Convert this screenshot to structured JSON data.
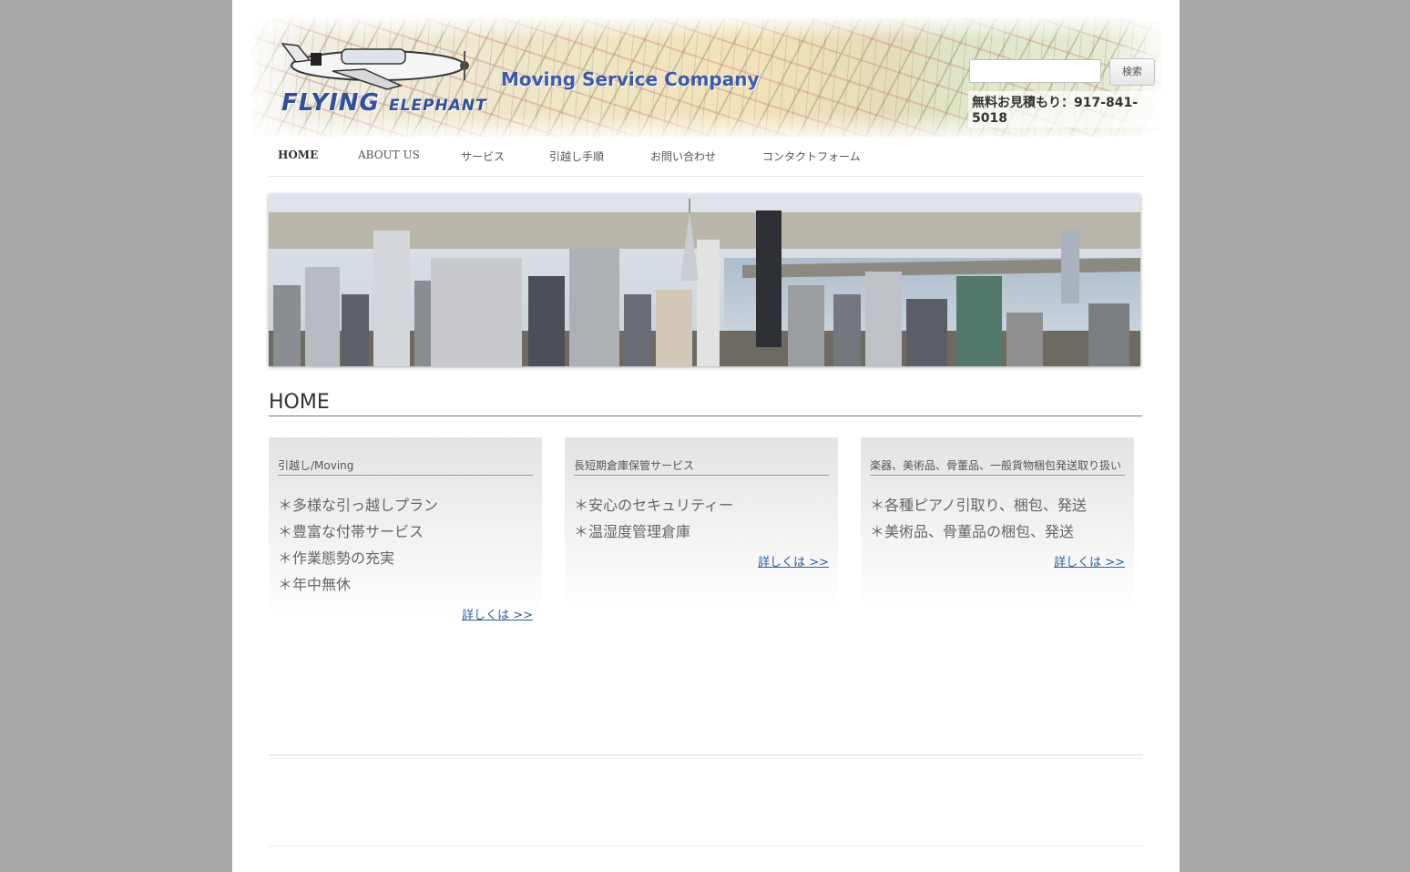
{
  "header": {
    "logo_main": "FLYING",
    "logo_small": "ELEPHANT",
    "tagline": "Moving Service Company",
    "search_placeholder": "",
    "search_button": "検索",
    "phone": "無料お見積もり：917-841-5018"
  },
  "nav": {
    "items": [
      {
        "label": "HOME"
      },
      {
        "label": "ABOUT US"
      },
      {
        "label": "サービス"
      },
      {
        "label": "引越し手順"
      },
      {
        "label": "お問い合わせ"
      },
      {
        "label": "コンタクトフォーム"
      }
    ]
  },
  "page_title": "HOME",
  "cards": [
    {
      "title": "引越し/Moving",
      "items": [
        "＊多様な引っ越しプラン",
        "＊豊富な付帯サービス",
        "＊作業態勢の充実",
        "＊年中無休"
      ],
      "more": "詳しくは >>"
    },
    {
      "title": "長短期倉庫保管サービス",
      "items": [
        "＊安心のセキュリティー",
        "＊温湿度管理倉庫"
      ],
      "more": "詳しくは >>"
    },
    {
      "title": "楽器、美術品、骨董品、一般貨物梱包発送取り扱い",
      "items": [
        "＊各種ピアノ引取り、梱包、発送",
        "＊美術品、骨董品の梱包、発送"
      ],
      "more": "詳しくは >>"
    }
  ],
  "colors": {
    "page_bg": "#a9a9a9",
    "logo_blue": "#2f4f9f",
    "link_blue": "#2a5d9c"
  }
}
